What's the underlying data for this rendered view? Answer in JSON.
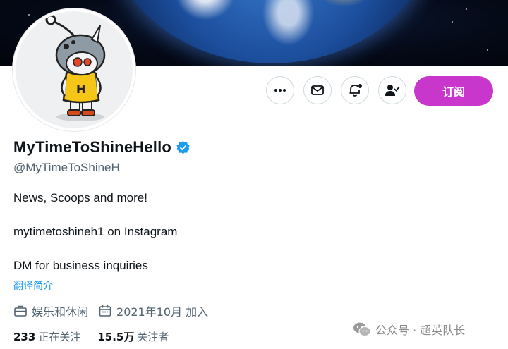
{
  "profile": {
    "display_name": "MyTimeToShineHello",
    "handle": "@MyTimeToShineH",
    "bio_lines": [
      "News, Scoops and more!",
      "mytimetoshineh1 on Instagram",
      "DM for business inquiries"
    ],
    "translate_link": "翻译简介",
    "category": "娱乐和休闲",
    "joined": "2021年10月 加入"
  },
  "actions": {
    "more_icon": "more-dots-icon",
    "message_icon": "envelope-icon",
    "notify_icon": "bell-plus-icon",
    "follow_icon": "person-check-icon",
    "subscribe_label": "订阅"
  },
  "stats": {
    "following_count": "233",
    "following_label": "正在关注",
    "followers_count": "15.5万",
    "followers_label": "关注者"
  },
  "watermark": {
    "text": "公众号 · 超英队长"
  },
  "colors": {
    "subscribe": "#c936cc",
    "verified": "#1d9bf0",
    "link": "#1d9bf0",
    "secondary_text": "#536471"
  }
}
